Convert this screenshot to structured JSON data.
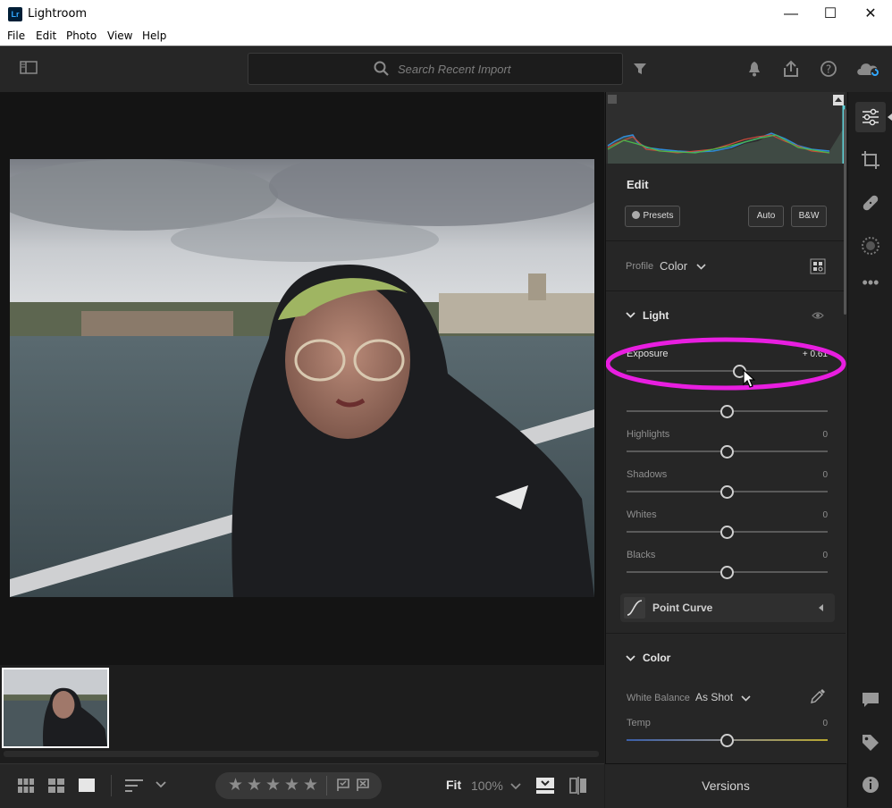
{
  "window": {
    "title": "Lightroom",
    "icon_text": "Lr",
    "minimize": "—",
    "maximize": "☐",
    "close": "✕"
  },
  "menu": [
    "File",
    "Edit",
    "Photo",
    "View",
    "Help"
  ],
  "toolbar": {
    "search_placeholder": "Search Recent Import"
  },
  "edit_panel": {
    "title": "Edit",
    "presets_label": "Presets",
    "auto_label": "Auto",
    "bw_label": "B&W",
    "profile_label": "Profile",
    "profile_value": "Color",
    "light_section": "Light",
    "sliders": [
      {
        "label": "Exposure",
        "value": "+ 0.61",
        "position": 0.56
      },
      {
        "label": "",
        "value": "",
        "position": 0.5
      },
      {
        "label": "Highlights",
        "value": "0",
        "position": 0.5
      },
      {
        "label": "Shadows",
        "value": "0",
        "position": 0.5
      },
      {
        "label": "Whites",
        "value": "0",
        "position": 0.5
      },
      {
        "label": "Blacks",
        "value": "0",
        "position": 0.5
      }
    ],
    "point_curve_label": "Point Curve",
    "color_section": "Color",
    "white_balance_label": "White Balance",
    "white_balance_value": "As Shot",
    "temp_label": "Temp",
    "temp_value": "0",
    "temp_position": 0.5
  },
  "versions_label": "Versions",
  "bottombar": {
    "fit_label": "Fit",
    "zoom_label": "100%"
  },
  "colors": {
    "highlight_ring": "#e81ee0",
    "accent": "#31a8ff"
  }
}
